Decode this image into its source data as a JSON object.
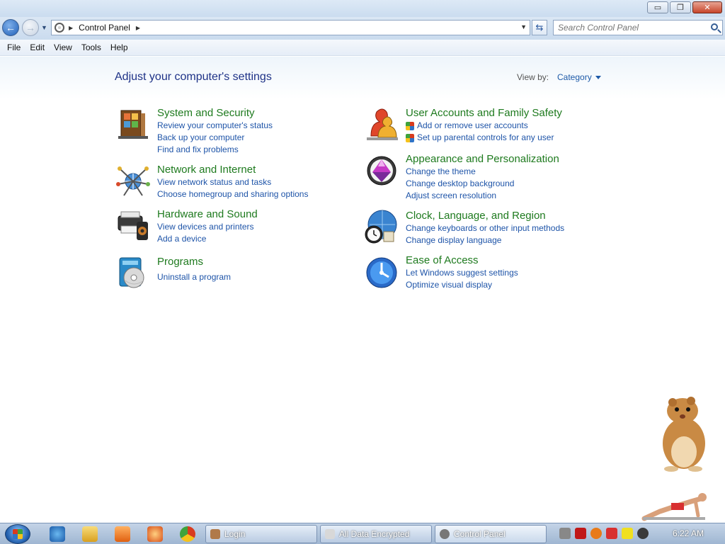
{
  "window": {
    "buttons": {
      "minimize": "▭",
      "restore": "❐",
      "close": "✕"
    }
  },
  "address": {
    "path": "Control Panel",
    "search_placeholder": "Search Control Panel"
  },
  "menu": [
    "File",
    "Edit",
    "View",
    "Tools",
    "Help"
  ],
  "main": {
    "title": "Adjust your computer's settings",
    "view_by_label": "View by:",
    "view_by_value": "Category"
  },
  "categories": [
    {
      "title": "System and Security",
      "icon": "system-security-icon",
      "links": [
        "Review your computer's status",
        "Back up your computer",
        "Find and fix problems"
      ]
    },
    {
      "title": "Network and Internet",
      "icon": "network-internet-icon",
      "links": [
        "View network status and tasks",
        "Choose homegroup and sharing options"
      ]
    },
    {
      "title": "Hardware and Sound",
      "icon": "hardware-sound-icon",
      "links": [
        "View devices and printers",
        "Add a device"
      ]
    },
    {
      "title": "Programs",
      "icon": "programs-icon",
      "links": [
        "Uninstall a program"
      ]
    },
    {
      "title": "User Accounts and Family Safety",
      "icon": "user-accounts-icon",
      "links": [
        "Add or remove user accounts",
        "Set up parental controls for any user"
      ]
    },
    {
      "title": "Appearance and Personalization",
      "icon": "appearance-icon",
      "links": [
        "Change the theme",
        "Change desktop background",
        "Adjust screen resolution"
      ]
    },
    {
      "title": "Clock, Language, and Region",
      "icon": "clock-language-icon",
      "links": [
        "Change keyboards or other input methods",
        "Change display language"
      ]
    },
    {
      "title": "Ease of Access",
      "icon": "ease-of-access-icon",
      "links": [
        "Let Windows suggest settings",
        "Optimize visual display"
      ]
    }
  ],
  "taskbar": {
    "tasks": [
      "Login",
      "All Data Encrypted",
      "Control Panel"
    ],
    "time": "6:22 AM"
  },
  "colors": {
    "category_title": "#1e7a1e",
    "link": "#1e54a8",
    "page_title": "#1e3287"
  }
}
